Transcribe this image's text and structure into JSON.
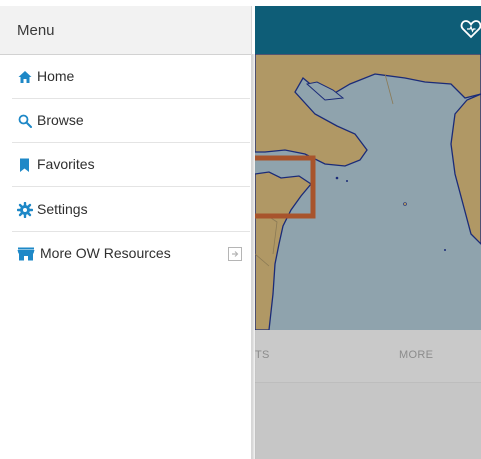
{
  "drawer": {
    "title": "Menu",
    "items": [
      {
        "label": "Home",
        "icon": "home-icon"
      },
      {
        "label": "Browse",
        "icon": "search-icon"
      },
      {
        "label": "Favorites",
        "icon": "bookmark-icon"
      },
      {
        "label": "Settings",
        "icon": "gear-icon"
      },
      {
        "label": "More OW Resources",
        "icon": "store-icon",
        "trailing_icon": "external-link-icon"
      }
    ]
  },
  "background": {
    "tabs": [
      "TS",
      "MORE"
    ],
    "header_icon": "favorite-heart-icon"
  },
  "colors": {
    "header": "#0e5d77",
    "accent": "#1e88c7",
    "sea": "#8fa3ad",
    "land": "#b09865",
    "highlight_box": "#a8542c"
  }
}
